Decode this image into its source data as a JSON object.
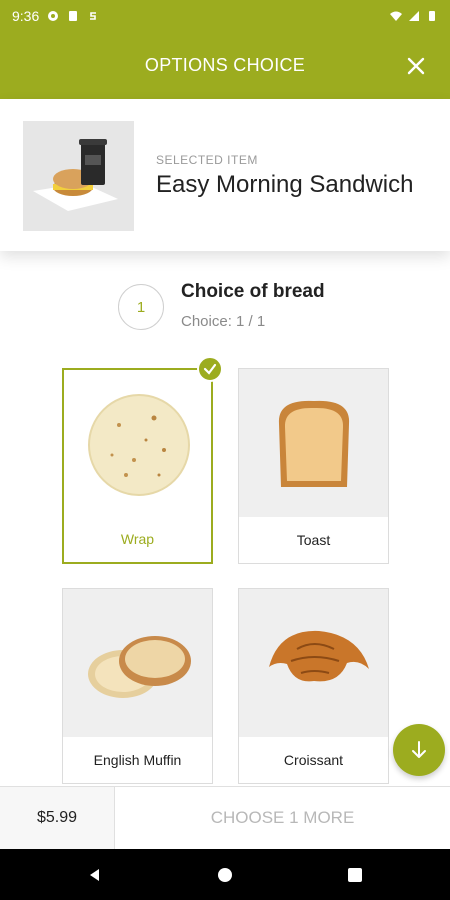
{
  "status_bar": {
    "time": "9:36",
    "left_icons": [
      "chat-icon",
      "sim-icon",
      "s-icon"
    ],
    "right_icons": [
      "wifi-icon",
      "cell-signal-icon",
      "battery-icon"
    ]
  },
  "header": {
    "title": "OPTIONS CHOICE",
    "close_icon": "close-icon"
  },
  "selected_item": {
    "caption": "SELECTED ITEM",
    "name": "Easy Morning Sandwich"
  },
  "step": {
    "number": "1",
    "title": "Choice of bread",
    "subtitle": "Choice: 1 / 1"
  },
  "options": [
    {
      "label": "Wrap",
      "selected": true
    },
    {
      "label": "Toast",
      "selected": false
    },
    {
      "label": "English Muffin",
      "selected": false
    },
    {
      "label": "Croissant",
      "selected": false
    }
  ],
  "footer": {
    "price": "$5.99",
    "action": "CHOOSE 1 MORE"
  },
  "colors": {
    "accent": "#9cac1f",
    "muted_text": "#8a8a8a",
    "disabled_text": "#b8b8b8"
  },
  "nav": {
    "icons": [
      "back-icon",
      "home-icon",
      "recents-icon"
    ]
  }
}
